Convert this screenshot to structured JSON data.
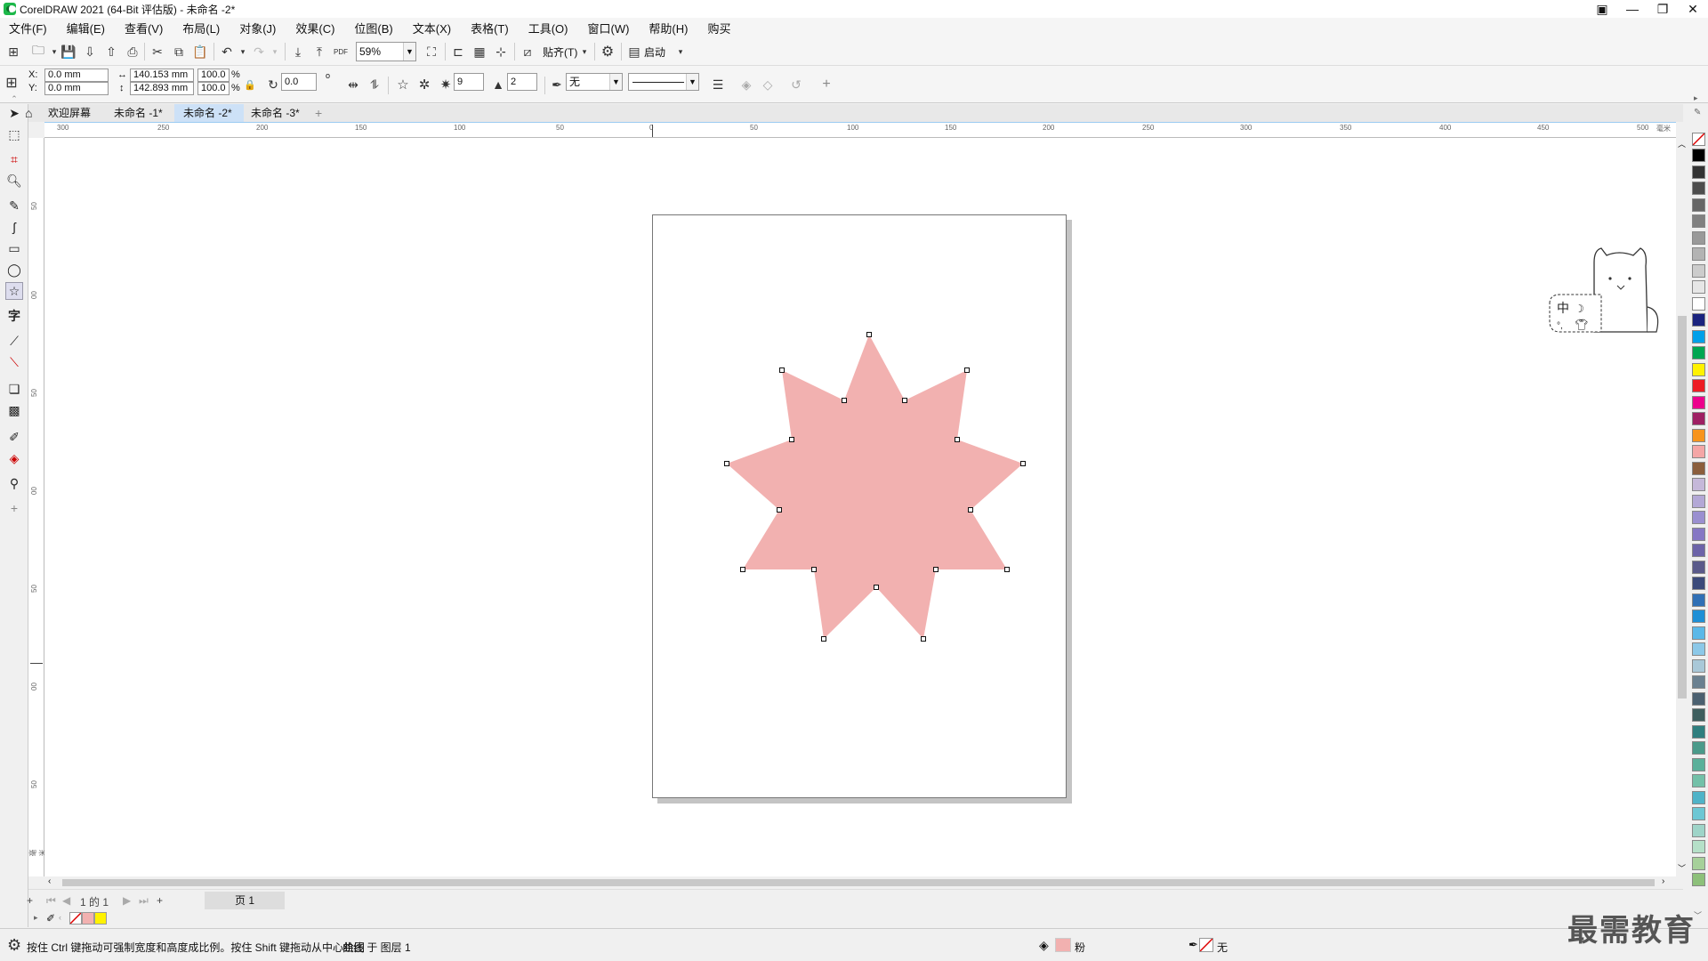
{
  "window": {
    "title": "CorelDRAW 2021 (64-Bit 评估版) - 未命名 -2*"
  },
  "menu": [
    "文件(F)",
    "编辑(E)",
    "查看(V)",
    "布局(L)",
    "对象(J)",
    "效果(C)",
    "位图(B)",
    "文本(X)",
    "表格(T)",
    "工具(O)",
    "窗口(W)",
    "帮助(H)",
    "购买"
  ],
  "toolbar": {
    "zoom_value": "59%",
    "snap_label": "贴齐(T)",
    "launch_label": "启动"
  },
  "propbar": {
    "x_label": "X:",
    "y_label": "Y:",
    "x_value": "0.0 mm",
    "y_value": "0.0 mm",
    "width_value": "140.153 mm",
    "height_value": "142.893 mm",
    "scale_w": "100.0",
    "scale_h": "100.0",
    "percent": "%",
    "rotation": "0.0",
    "degree": "o",
    "points": "9",
    "sharpness": "2",
    "outline": "无"
  },
  "tabs": [
    {
      "label": "欢迎屏幕",
      "active": false
    },
    {
      "label": "未命名 -1*",
      "active": false
    },
    {
      "label": "未命名 -2*",
      "active": true
    },
    {
      "label": "未命名 -3*",
      "active": false
    }
  ],
  "ruler_h": [
    "300",
    "250",
    "200",
    "150",
    "100",
    "50",
    "0",
    "50",
    "100",
    "150",
    "200",
    "250",
    "300",
    "350",
    "400",
    "450",
    "500",
    "毫米"
  ],
  "ruler_v": [
    "50",
    "00",
    "50",
    "00",
    "50",
    "00",
    "50",
    "00",
    "0",
    "0",
    "毫米"
  ],
  "pagenav": {
    "page_of": "1 的 1",
    "page_tab": "页 1"
  },
  "status": {
    "hint": "按住 Ctrl 键拖动可强制宽度和高度成比例。按住 Shift 键拖动从中心绘图",
    "object_info": "曲线 于 图层 1",
    "fill_label": "粉",
    "outline_label": "无"
  },
  "colors": {
    "star_fill": "#f2b1b0",
    "accent": "#cde1f7"
  },
  "palette_colors": [
    "#000000",
    "#333333",
    "#4d4d4d",
    "#666666",
    "#808080",
    "#999999",
    "#b3b3b3",
    "#cccccc",
    "#e6e6e6",
    "#ffffff",
    "#1a237e",
    "#00a0e9",
    "#00a651",
    "#fff200",
    "#ed1c24",
    "#ec008c",
    "#9e1f63",
    "#f7941d",
    "#f4a6a6",
    "#8b5e3c",
    "#c5b8d9",
    "#b3a8d6",
    "#9a8fd0",
    "#8577c4",
    "#6c63a8",
    "#5a5a8a",
    "#3b4a7a",
    "#2f6fb5",
    "#1e8fd6",
    "#5bb8e8",
    "#8cc8e8",
    "#a9c8d8",
    "#6a8090",
    "#4b6070",
    "#3e5e5e",
    "#2f7f7f",
    "#4a9a8a",
    "#5ab09a",
    "#73c0a8",
    "#4fb3c8",
    "#6cc7d4",
    "#9ed4c8",
    "#b5e0c8",
    "#a6d09a",
    "#8dc07a"
  ],
  "doc_palette": [
    "#f2b1b0",
    "#fff200"
  ],
  "watermark": "最需教育"
}
